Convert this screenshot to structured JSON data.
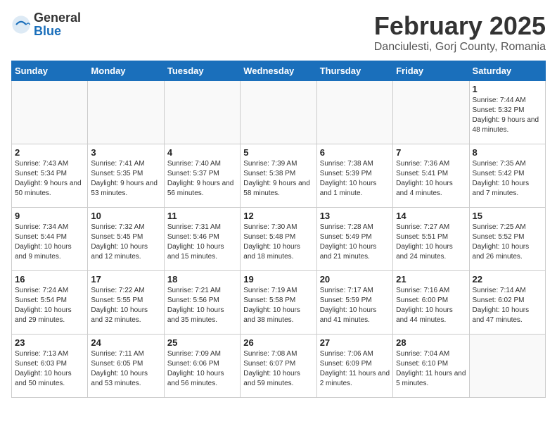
{
  "header": {
    "logo_general": "General",
    "logo_blue": "Blue",
    "title": "February 2025",
    "subtitle": "Danciulesti, Gorj County, Romania"
  },
  "calendar": {
    "days_of_week": [
      "Sunday",
      "Monday",
      "Tuesday",
      "Wednesday",
      "Thursday",
      "Friday",
      "Saturday"
    ],
    "weeks": [
      [
        {
          "day": "",
          "info": ""
        },
        {
          "day": "",
          "info": ""
        },
        {
          "day": "",
          "info": ""
        },
        {
          "day": "",
          "info": ""
        },
        {
          "day": "",
          "info": ""
        },
        {
          "day": "",
          "info": ""
        },
        {
          "day": "1",
          "info": "Sunrise: 7:44 AM\nSunset: 5:32 PM\nDaylight: 9 hours and 48 minutes."
        }
      ],
      [
        {
          "day": "2",
          "info": "Sunrise: 7:43 AM\nSunset: 5:34 PM\nDaylight: 9 hours and 50 minutes."
        },
        {
          "day": "3",
          "info": "Sunrise: 7:41 AM\nSunset: 5:35 PM\nDaylight: 9 hours and 53 minutes."
        },
        {
          "day": "4",
          "info": "Sunrise: 7:40 AM\nSunset: 5:37 PM\nDaylight: 9 hours and 56 minutes."
        },
        {
          "day": "5",
          "info": "Sunrise: 7:39 AM\nSunset: 5:38 PM\nDaylight: 9 hours and 58 minutes."
        },
        {
          "day": "6",
          "info": "Sunrise: 7:38 AM\nSunset: 5:39 PM\nDaylight: 10 hours and 1 minute."
        },
        {
          "day": "7",
          "info": "Sunrise: 7:36 AM\nSunset: 5:41 PM\nDaylight: 10 hours and 4 minutes."
        },
        {
          "day": "8",
          "info": "Sunrise: 7:35 AM\nSunset: 5:42 PM\nDaylight: 10 hours and 7 minutes."
        }
      ],
      [
        {
          "day": "9",
          "info": "Sunrise: 7:34 AM\nSunset: 5:44 PM\nDaylight: 10 hours and 9 minutes."
        },
        {
          "day": "10",
          "info": "Sunrise: 7:32 AM\nSunset: 5:45 PM\nDaylight: 10 hours and 12 minutes."
        },
        {
          "day": "11",
          "info": "Sunrise: 7:31 AM\nSunset: 5:46 PM\nDaylight: 10 hours and 15 minutes."
        },
        {
          "day": "12",
          "info": "Sunrise: 7:30 AM\nSunset: 5:48 PM\nDaylight: 10 hours and 18 minutes."
        },
        {
          "day": "13",
          "info": "Sunrise: 7:28 AM\nSunset: 5:49 PM\nDaylight: 10 hours and 21 minutes."
        },
        {
          "day": "14",
          "info": "Sunrise: 7:27 AM\nSunset: 5:51 PM\nDaylight: 10 hours and 24 minutes."
        },
        {
          "day": "15",
          "info": "Sunrise: 7:25 AM\nSunset: 5:52 PM\nDaylight: 10 hours and 26 minutes."
        }
      ],
      [
        {
          "day": "16",
          "info": "Sunrise: 7:24 AM\nSunset: 5:54 PM\nDaylight: 10 hours and 29 minutes."
        },
        {
          "day": "17",
          "info": "Sunrise: 7:22 AM\nSunset: 5:55 PM\nDaylight: 10 hours and 32 minutes."
        },
        {
          "day": "18",
          "info": "Sunrise: 7:21 AM\nSunset: 5:56 PM\nDaylight: 10 hours and 35 minutes."
        },
        {
          "day": "19",
          "info": "Sunrise: 7:19 AM\nSunset: 5:58 PM\nDaylight: 10 hours and 38 minutes."
        },
        {
          "day": "20",
          "info": "Sunrise: 7:17 AM\nSunset: 5:59 PM\nDaylight: 10 hours and 41 minutes."
        },
        {
          "day": "21",
          "info": "Sunrise: 7:16 AM\nSunset: 6:00 PM\nDaylight: 10 hours and 44 minutes."
        },
        {
          "day": "22",
          "info": "Sunrise: 7:14 AM\nSunset: 6:02 PM\nDaylight: 10 hours and 47 minutes."
        }
      ],
      [
        {
          "day": "23",
          "info": "Sunrise: 7:13 AM\nSunset: 6:03 PM\nDaylight: 10 hours and 50 minutes."
        },
        {
          "day": "24",
          "info": "Sunrise: 7:11 AM\nSunset: 6:05 PM\nDaylight: 10 hours and 53 minutes."
        },
        {
          "day": "25",
          "info": "Sunrise: 7:09 AM\nSunset: 6:06 PM\nDaylight: 10 hours and 56 minutes."
        },
        {
          "day": "26",
          "info": "Sunrise: 7:08 AM\nSunset: 6:07 PM\nDaylight: 10 hours and 59 minutes."
        },
        {
          "day": "27",
          "info": "Sunrise: 7:06 AM\nSunset: 6:09 PM\nDaylight: 11 hours and 2 minutes."
        },
        {
          "day": "28",
          "info": "Sunrise: 7:04 AM\nSunset: 6:10 PM\nDaylight: 11 hours and 5 minutes."
        },
        {
          "day": "",
          "info": ""
        }
      ]
    ]
  }
}
